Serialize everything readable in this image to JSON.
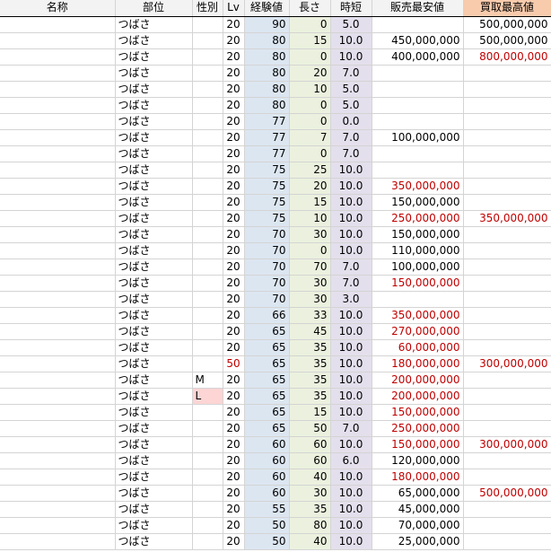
{
  "headers": {
    "name": "名称",
    "part": "部位",
    "sex": "性別",
    "lv": "Lv",
    "exp": "経験値",
    "length": "長さ",
    "time": "時短",
    "min_sell": "販売最安値",
    "max_buy": "買取最高値"
  },
  "colors": {
    "header_bg": "#f3f3f3",
    "max_buy_header_bg": "#f8cbad",
    "exp_bg": "#dce6f1",
    "length_bg": "#ebf1de",
    "time_bg": "#e4dfec",
    "sex_l_bg": "#fcd5d4",
    "red_text": "#c00000"
  },
  "rows": [
    {
      "part": "つばさ",
      "sex": "",
      "lv": "20",
      "exp": "90",
      "length": "0",
      "time": "5.0",
      "min": "",
      "max": "500,000,000",
      "min_red": false,
      "max_red": false
    },
    {
      "part": "つばさ",
      "sex": "",
      "lv": "20",
      "exp": "80",
      "length": "15",
      "time": "10.0",
      "min": "450,000,000",
      "max": "500,000,000",
      "min_red": false,
      "max_red": false
    },
    {
      "part": "つばさ",
      "sex": "",
      "lv": "20",
      "exp": "80",
      "length": "0",
      "time": "10.0",
      "min": "400,000,000",
      "max": "800,000,000",
      "min_red": false,
      "max_red": true
    },
    {
      "part": "つばさ",
      "sex": "",
      "lv": "20",
      "exp": "80",
      "length": "20",
      "time": "7.0",
      "min": "",
      "max": "",
      "min_red": false,
      "max_red": false
    },
    {
      "part": "つばさ",
      "sex": "",
      "lv": "20",
      "exp": "80",
      "length": "10",
      "time": "5.0",
      "min": "",
      "max": "",
      "min_red": false,
      "max_red": false
    },
    {
      "part": "つばさ",
      "sex": "",
      "lv": "20",
      "exp": "80",
      "length": "0",
      "time": "5.0",
      "min": "",
      "max": "",
      "min_red": false,
      "max_red": false
    },
    {
      "part": "つばさ",
      "sex": "",
      "lv": "20",
      "exp": "77",
      "length": "0",
      "time": "0.0",
      "min": "",
      "max": "",
      "min_red": false,
      "max_red": false
    },
    {
      "part": "つばさ",
      "sex": "",
      "lv": "20",
      "exp": "77",
      "length": "7",
      "time": "7.0",
      "min": "100,000,000",
      "max": "",
      "min_red": false,
      "max_red": false
    },
    {
      "part": "つばさ",
      "sex": "",
      "lv": "20",
      "exp": "77",
      "length": "0",
      "time": "7.0",
      "min": "",
      "max": "",
      "min_red": false,
      "max_red": false
    },
    {
      "part": "つばさ",
      "sex": "",
      "lv": "20",
      "exp": "75",
      "length": "25",
      "time": "10.0",
      "min": "",
      "max": "",
      "min_red": false,
      "max_red": false
    },
    {
      "part": "つばさ",
      "sex": "",
      "lv": "20",
      "exp": "75",
      "length": "20",
      "time": "10.0",
      "min": "350,000,000",
      "max": "",
      "min_red": true,
      "max_red": false
    },
    {
      "part": "つばさ",
      "sex": "",
      "lv": "20",
      "exp": "75",
      "length": "15",
      "time": "10.0",
      "min": "150,000,000",
      "max": "",
      "min_red": false,
      "max_red": false
    },
    {
      "part": "つばさ",
      "sex": "",
      "lv": "20",
      "exp": "75",
      "length": "10",
      "time": "10.0",
      "min": "250,000,000",
      "max": "350,000,000",
      "min_red": true,
      "max_red": true
    },
    {
      "part": "つばさ",
      "sex": "",
      "lv": "20",
      "exp": "70",
      "length": "30",
      "time": "10.0",
      "min": "150,000,000",
      "max": "",
      "min_red": false,
      "max_red": false
    },
    {
      "part": "つばさ",
      "sex": "",
      "lv": "20",
      "exp": "70",
      "length": "0",
      "time": "10.0",
      "min": "110,000,000",
      "max": "",
      "min_red": false,
      "max_red": false
    },
    {
      "part": "つばさ",
      "sex": "",
      "lv": "20",
      "exp": "70",
      "length": "70",
      "time": "7.0",
      "min": "100,000,000",
      "max": "",
      "min_red": false,
      "max_red": false
    },
    {
      "part": "つばさ",
      "sex": "",
      "lv": "20",
      "exp": "70",
      "length": "30",
      "time": "7.0",
      "min": "150,000,000",
      "max": "",
      "min_red": true,
      "max_red": false
    },
    {
      "part": "つばさ",
      "sex": "",
      "lv": "20",
      "exp": "70",
      "length": "30",
      "time": "3.0",
      "min": "",
      "max": "",
      "min_red": false,
      "max_red": false
    },
    {
      "part": "つばさ",
      "sex": "",
      "lv": "20",
      "exp": "66",
      "length": "33",
      "time": "10.0",
      "min": "350,000,000",
      "max": "",
      "min_red": true,
      "max_red": false
    },
    {
      "part": "つばさ",
      "sex": "",
      "lv": "20",
      "exp": "65",
      "length": "45",
      "time": "10.0",
      "min": "270,000,000",
      "max": "",
      "min_red": true,
      "max_red": false
    },
    {
      "part": "つばさ",
      "sex": "",
      "lv": "20",
      "exp": "65",
      "length": "35",
      "time": "10.0",
      "min": "60,000,000",
      "max": "",
      "min_red": true,
      "max_red": false
    },
    {
      "part": "つばさ",
      "sex": "",
      "lv": "50",
      "exp": "65",
      "length": "35",
      "time": "10.0",
      "min": "180,000,000",
      "max": "300,000,000",
      "min_red": true,
      "max_red": true,
      "lv_red": true
    },
    {
      "part": "つばさ",
      "sex": "M",
      "lv": "20",
      "exp": "65",
      "length": "35",
      "time": "10.0",
      "min": "200,000,000",
      "max": "",
      "min_red": true,
      "max_red": false
    },
    {
      "part": "つばさ",
      "sex": "L",
      "lv": "20",
      "exp": "65",
      "length": "35",
      "time": "10.0",
      "min": "200,000,000",
      "max": "",
      "min_red": true,
      "max_red": false,
      "sex_pink": true
    },
    {
      "part": "つばさ",
      "sex": "",
      "lv": "20",
      "exp": "65",
      "length": "15",
      "time": "10.0",
      "min": "150,000,000",
      "max": "",
      "min_red": true,
      "max_red": false
    },
    {
      "part": "つばさ",
      "sex": "",
      "lv": "20",
      "exp": "65",
      "length": "50",
      "time": "7.0",
      "min": "250,000,000",
      "max": "",
      "min_red": true,
      "max_red": false
    },
    {
      "part": "つばさ",
      "sex": "",
      "lv": "20",
      "exp": "60",
      "length": "60",
      "time": "10.0",
      "min": "150,000,000",
      "max": "300,000,000",
      "min_red": true,
      "max_red": true
    },
    {
      "part": "つばさ",
      "sex": "",
      "lv": "20",
      "exp": "60",
      "length": "60",
      "time": "6.0",
      "min": "120,000,000",
      "max": "",
      "min_red": false,
      "max_red": false
    },
    {
      "part": "つばさ",
      "sex": "",
      "lv": "20",
      "exp": "60",
      "length": "40",
      "time": "10.0",
      "min": "180,000,000",
      "max": "",
      "min_red": true,
      "max_red": false
    },
    {
      "part": "つばさ",
      "sex": "",
      "lv": "20",
      "exp": "60",
      "length": "30",
      "time": "10.0",
      "min": "65,000,000",
      "max": "500,000,000",
      "min_red": false,
      "max_red": true
    },
    {
      "part": "つばさ",
      "sex": "",
      "lv": "20",
      "exp": "55",
      "length": "35",
      "time": "10.0",
      "min": "45,000,000",
      "max": "",
      "min_red": false,
      "max_red": false
    },
    {
      "part": "つばさ",
      "sex": "",
      "lv": "20",
      "exp": "50",
      "length": "80",
      "time": "10.0",
      "min": "70,000,000",
      "max": "",
      "min_red": false,
      "max_red": false
    },
    {
      "part": "つばさ",
      "sex": "",
      "lv": "20",
      "exp": "50",
      "length": "40",
      "time": "10.0",
      "min": "25,000,000",
      "max": "",
      "min_red": false,
      "max_red": false
    }
  ]
}
